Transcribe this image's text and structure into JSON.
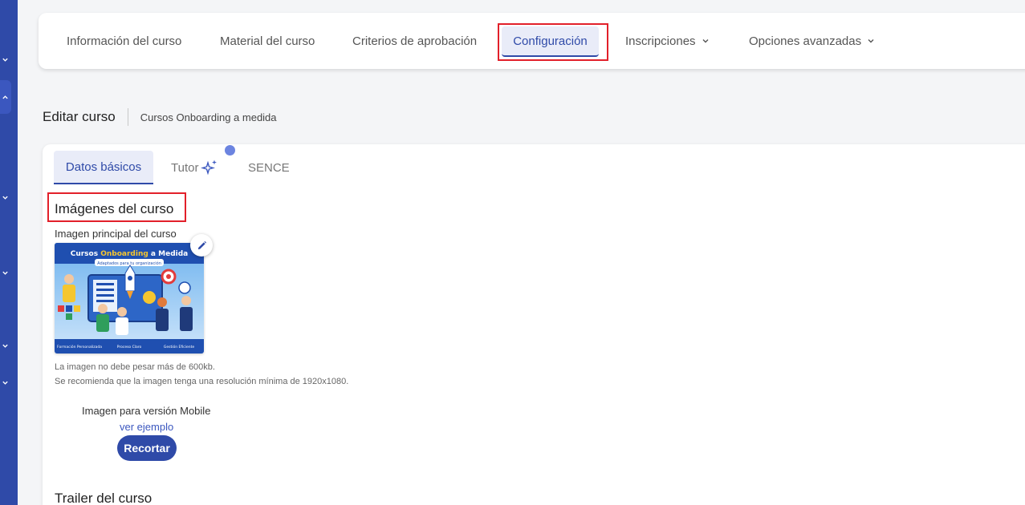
{
  "nav": {
    "tabs": [
      {
        "label": "Información del curso"
      },
      {
        "label": "Material del curso"
      },
      {
        "label": "Criterios de aprobación"
      },
      {
        "label": "Configuración"
      },
      {
        "label": "Inscripciones"
      },
      {
        "label": "Opciones avanzadas"
      }
    ],
    "active_index": 3
  },
  "page": {
    "title": "Editar curso",
    "subtitle": "Cursos Onboarding a medida"
  },
  "subtabs": [
    {
      "label": "Datos básicos"
    },
    {
      "label": "Tutor"
    },
    {
      "label": "SENCE"
    }
  ],
  "images_section": {
    "title": "Imágenes del curso",
    "main_label": "Imagen principal del curso",
    "thumbnail": {
      "title_part1": "Cursos ",
      "title_highlight": "Onboarding",
      "title_part2": " a Medida",
      "tagline": "Adaptados para tu organización",
      "footer": [
        "Formación Personalizada",
        "Proceso Claro",
        "Gestión Eficiente"
      ]
    },
    "note_size": "La imagen no debe pesar más de 600kb.",
    "note_resolution": "Se recomienda que la imagen tenga una resolución mínima de 1920x1080.",
    "mobile_label": "Imagen para versión Mobile",
    "example_link": "ver ejemplo",
    "crop_button": "Recortar"
  },
  "trailer": {
    "title": "Trailer del curso"
  },
  "colors": {
    "primary": "#2f4aa8",
    "highlight": "#e2202a",
    "active_bg": "#e9ecf8"
  }
}
